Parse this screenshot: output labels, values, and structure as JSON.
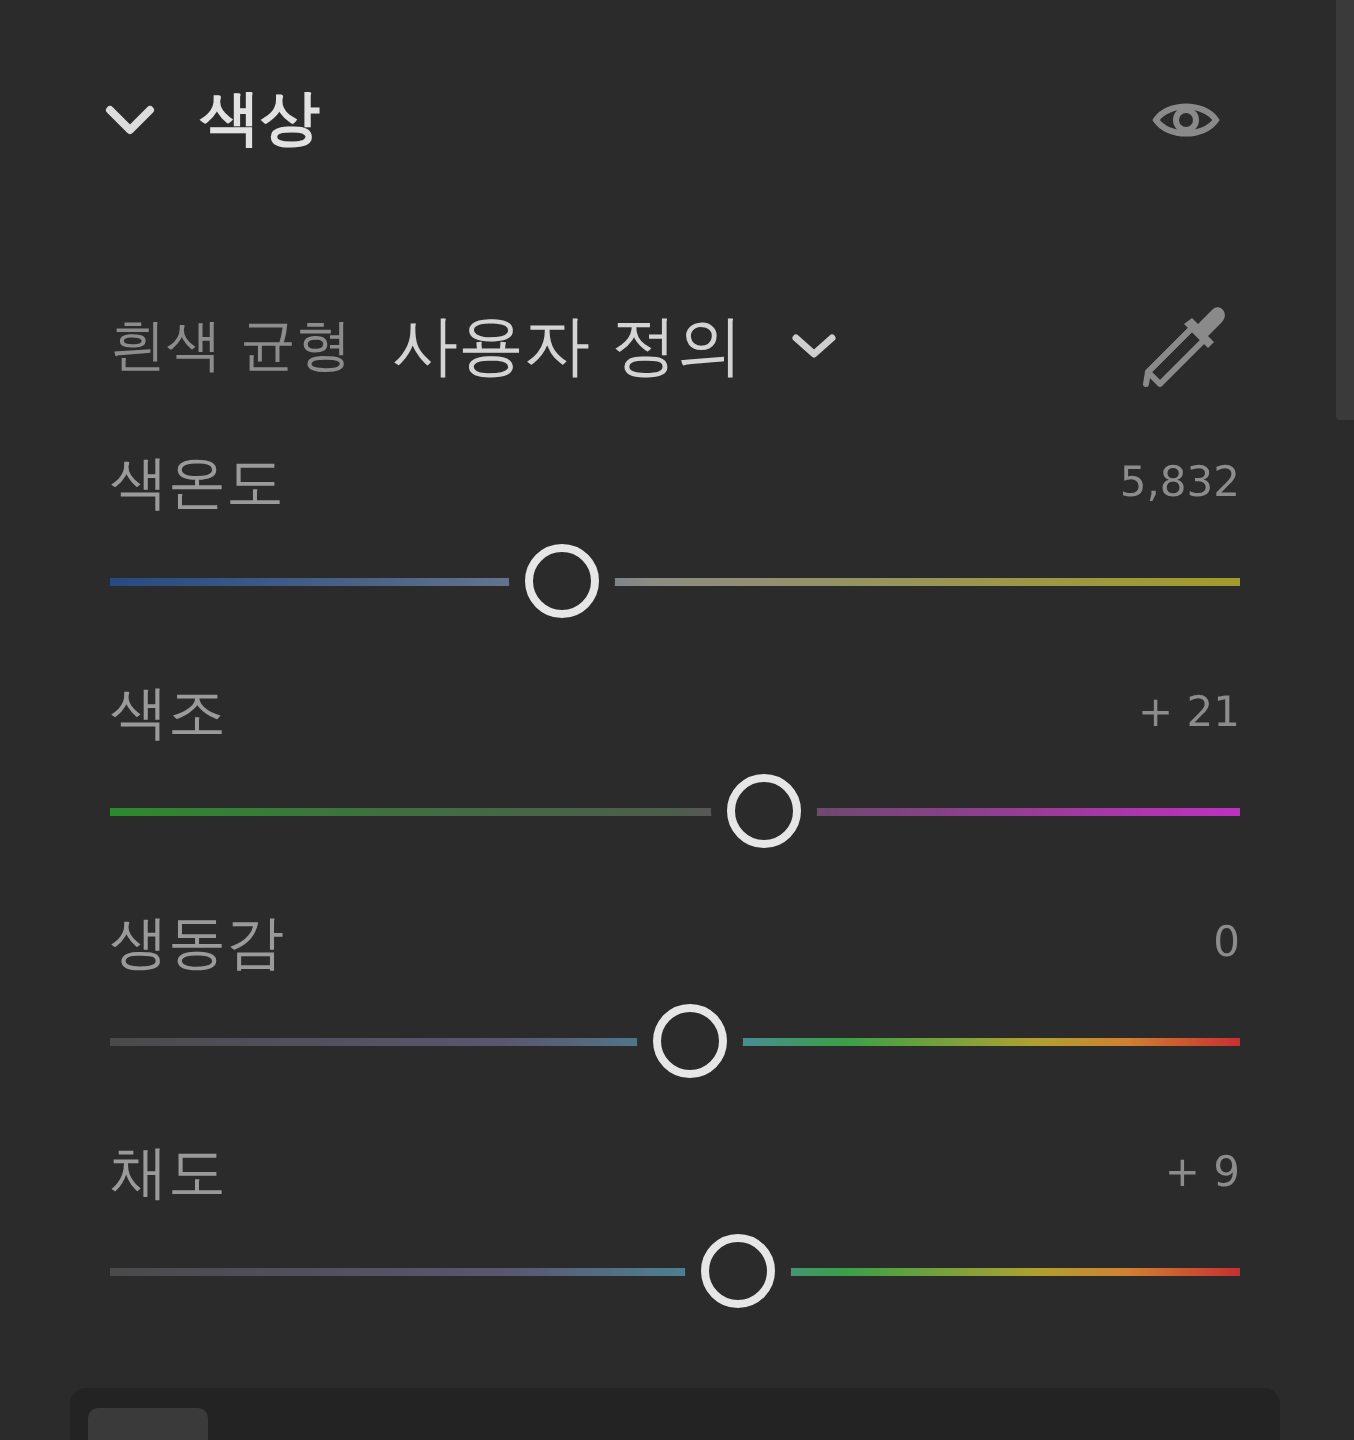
{
  "panel": {
    "title": "색상",
    "expanded": true
  },
  "white_balance": {
    "label": "흰색 균형",
    "value": "사용자 정의"
  },
  "sliders": [
    {
      "label": "색온도",
      "reading": "5,832",
      "level": 0.4,
      "kind": "temperature"
    },
    {
      "label": "색조",
      "reading": "+ 21",
      "level": 0.579,
      "kind": "tint"
    },
    {
      "label": "생동감",
      "reading": "0",
      "level": 0.513,
      "kind": "spectrum"
    },
    {
      "label": "채도",
      "reading": "+ 9",
      "level": 0.556,
      "kind": "spectrum"
    }
  ]
}
